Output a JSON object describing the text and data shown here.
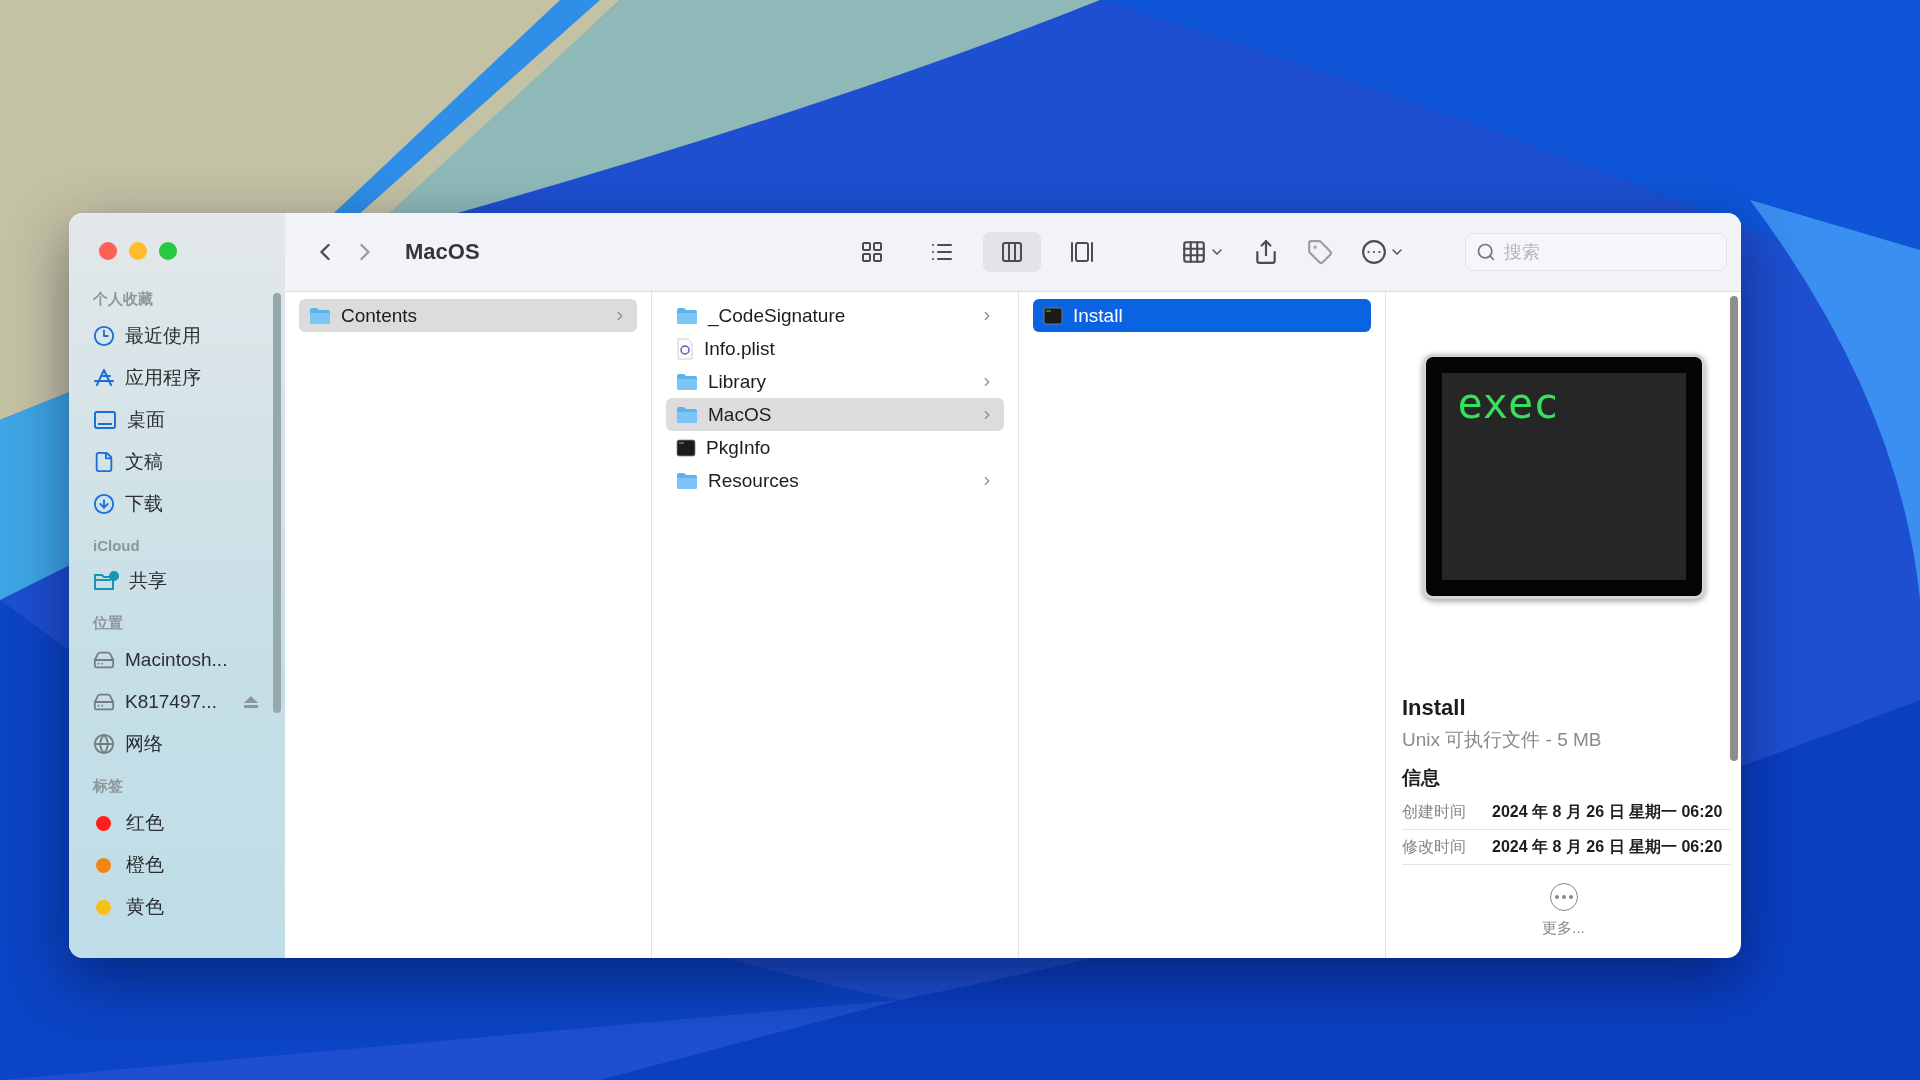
{
  "toolbar": {
    "title": "MacOS",
    "views": [
      {
        "kind": "icons",
        "selected": false
      },
      {
        "kind": "list",
        "selected": false
      },
      {
        "kind": "columns",
        "selected": true
      },
      {
        "kind": "gallery",
        "selected": false
      }
    ],
    "search": {
      "placeholder": "搜索"
    }
  },
  "sidebar": {
    "sections": [
      {
        "title": "个人收藏",
        "items": [
          {
            "kind": "recent",
            "label": "最近使用"
          },
          {
            "kind": "apps",
            "label": "应用程序"
          },
          {
            "kind": "desktop",
            "label": "桌面"
          },
          {
            "kind": "document",
            "label": "文稿"
          },
          {
            "kind": "download",
            "label": "下载"
          }
        ]
      },
      {
        "title": "iCloud",
        "items": [
          {
            "kind": "shared",
            "label": "共享"
          }
        ]
      },
      {
        "title": "位置",
        "items": [
          {
            "kind": "drive",
            "label": "Macintosh...",
            "ejectable": false
          },
          {
            "kind": "drive",
            "label": "K817497...",
            "ejectable": true
          },
          {
            "kind": "network",
            "label": "网络"
          }
        ]
      },
      {
        "title": "标签",
        "items": [
          {
            "kind": "tag",
            "label": "红色",
            "color": "#ff1e1e"
          },
          {
            "kind": "tag",
            "label": "橙色",
            "color": "#f28518"
          },
          {
            "kind": "tag",
            "label": "黄色",
            "color": "#f5c01a"
          }
        ]
      }
    ]
  },
  "columns": [
    {
      "active": false,
      "items": [
        {
          "kind": "folder",
          "name": "Contents",
          "selected": true
        }
      ]
    },
    {
      "active": false,
      "items": [
        {
          "kind": "folder",
          "name": "_CodeSignature",
          "selected": false
        },
        {
          "kind": "plist",
          "name": "Info.plist",
          "selected": false
        },
        {
          "kind": "folder",
          "name": "Library",
          "selected": false
        },
        {
          "kind": "folder",
          "name": "MacOS",
          "selected": true
        },
        {
          "kind": "exec",
          "name": "PkgInfo",
          "selected": false
        },
        {
          "kind": "folder",
          "name": "Resources",
          "selected": false
        }
      ]
    },
    {
      "active": true,
      "items": [
        {
          "kind": "exec",
          "name": "Install",
          "selected": true
        }
      ]
    }
  ],
  "preview": {
    "icon_text": "exec",
    "name": "Install",
    "kind_size": "Unix 可执行文件 - 5 MB",
    "info_title": "信息",
    "info": [
      {
        "label": "创建时间",
        "value": "2024 年 8 月 26 日 星期一 06:20"
      },
      {
        "label": "修改时间",
        "value": "2024 年 8 月 26 日 星期一 06:20"
      }
    ],
    "more": "更多..."
  }
}
